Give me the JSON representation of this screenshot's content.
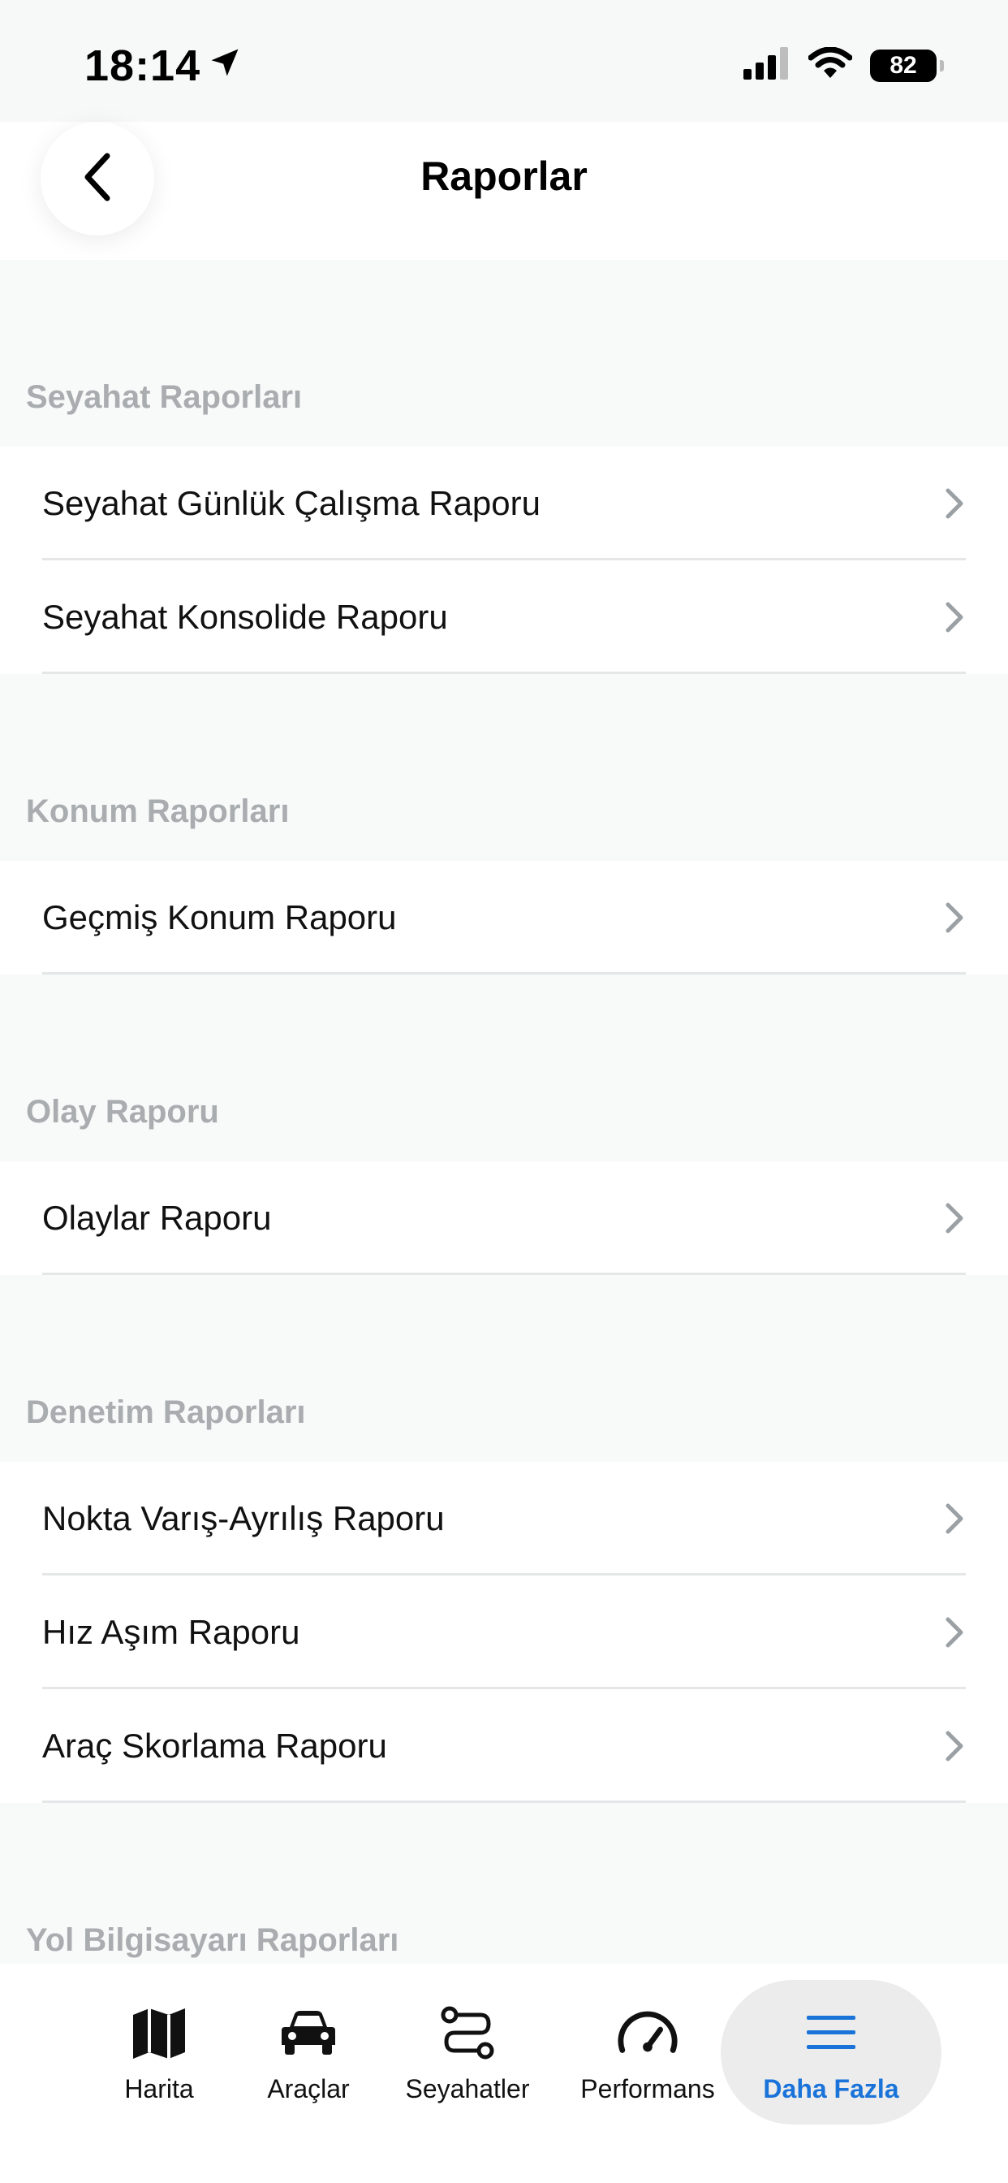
{
  "status_bar": {
    "time": "18:14",
    "battery": "82",
    "icons": [
      "location-arrow-icon",
      "cellular-signal-icon",
      "wifi-icon",
      "battery-icon"
    ]
  },
  "header": {
    "title": "Raporlar",
    "back_icon": "chevron-left-icon"
  },
  "sections": [
    {
      "title": "Seyahat Raporları",
      "items": [
        "Seyahat Günlük Çalışma Raporu",
        "Seyahat Konsolide Raporu"
      ]
    },
    {
      "title": "Konum Raporları",
      "items": [
        "Geçmiş Konum Raporu"
      ]
    },
    {
      "title": "Olay Raporu",
      "items": [
        "Olaylar Raporu"
      ]
    },
    {
      "title": "Denetim Raporları",
      "items": [
        "Nokta Varış-Ayrılış Raporu",
        "Hız Aşım Raporu",
        "Araç Skorlama Raporu"
      ]
    },
    {
      "title": "Yol Bilgisayarı Raporları",
      "items": []
    }
  ],
  "tab_bar": {
    "tabs": [
      {
        "label": "Harita",
        "icon": "map-icon",
        "active": false
      },
      {
        "label": "Araçlar",
        "icon": "car-icon",
        "active": false
      },
      {
        "label": "Seyahatler",
        "icon": "route-icon",
        "active": false
      },
      {
        "label": "Performans",
        "icon": "speedometer-icon",
        "active": false
      },
      {
        "label": "Daha Fazla",
        "icon": "menu-icon",
        "active": true
      }
    ]
  },
  "colors": {
    "accent": "#1a73d9",
    "section_title": "#a9adb0",
    "background": "#f8f9f9"
  }
}
